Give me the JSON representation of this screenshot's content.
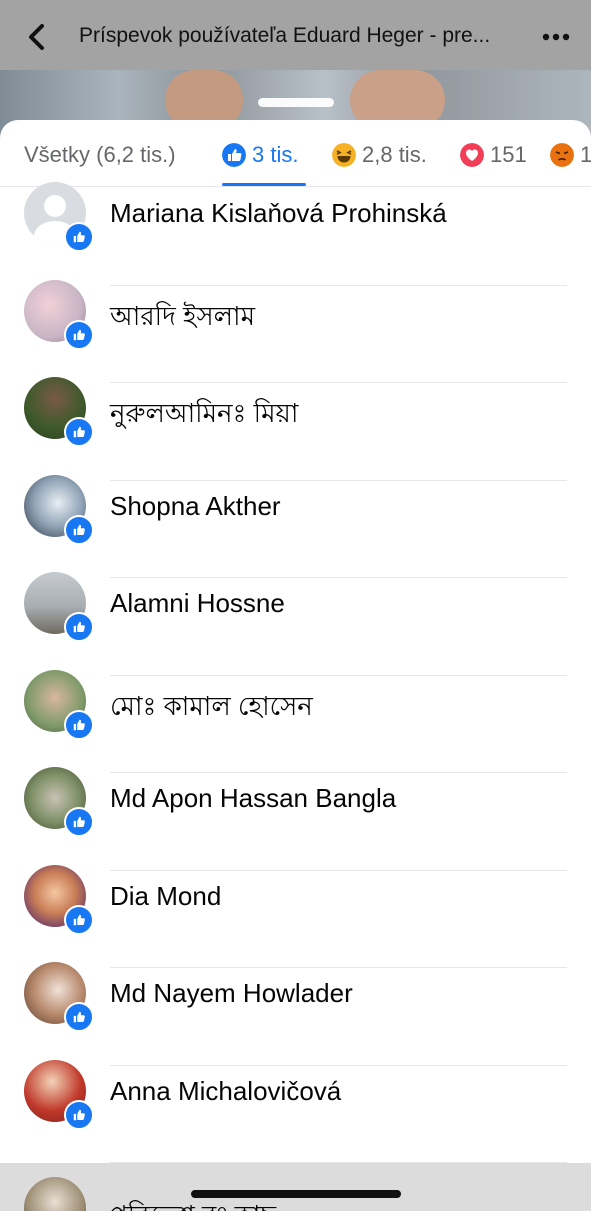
{
  "header": {
    "title": "Príspevok používateľa Eduard Heger - pre..."
  },
  "tabs": [
    {
      "label": "Všetky (6,2 tis.)",
      "icon": "none"
    },
    {
      "label": "3 tis.",
      "icon": "like-icon",
      "active": true
    },
    {
      "label": "2,8 tis.",
      "icon": "haha-icon"
    },
    {
      "label": "151",
      "icon": "love-icon"
    },
    {
      "label": "1",
      "icon": "angry-icon"
    }
  ],
  "reactors": [
    {
      "name": "Mariana Kislaňová Prohinská"
    },
    {
      "name": "আরদি ইসলাম"
    },
    {
      "name": "নুরুলআমিনঃ মিয়া"
    },
    {
      "name": "Shopna Akther"
    },
    {
      "name": "Alamni Hossne"
    },
    {
      "name": "মোঃ কামাল হোসেন"
    },
    {
      "name": "Md Apon Hassan Bangla"
    },
    {
      "name": "Dia Mond"
    },
    {
      "name": "Md Nayem Howlader"
    },
    {
      "name": "Anna Michalovičová"
    },
    {
      "name": "পরিতেশ রং কাছ"
    }
  ],
  "colors": {
    "accent": "#1877f2",
    "love": "#f33e58",
    "haha": "#f7b125",
    "angry": "#e9710f"
  }
}
